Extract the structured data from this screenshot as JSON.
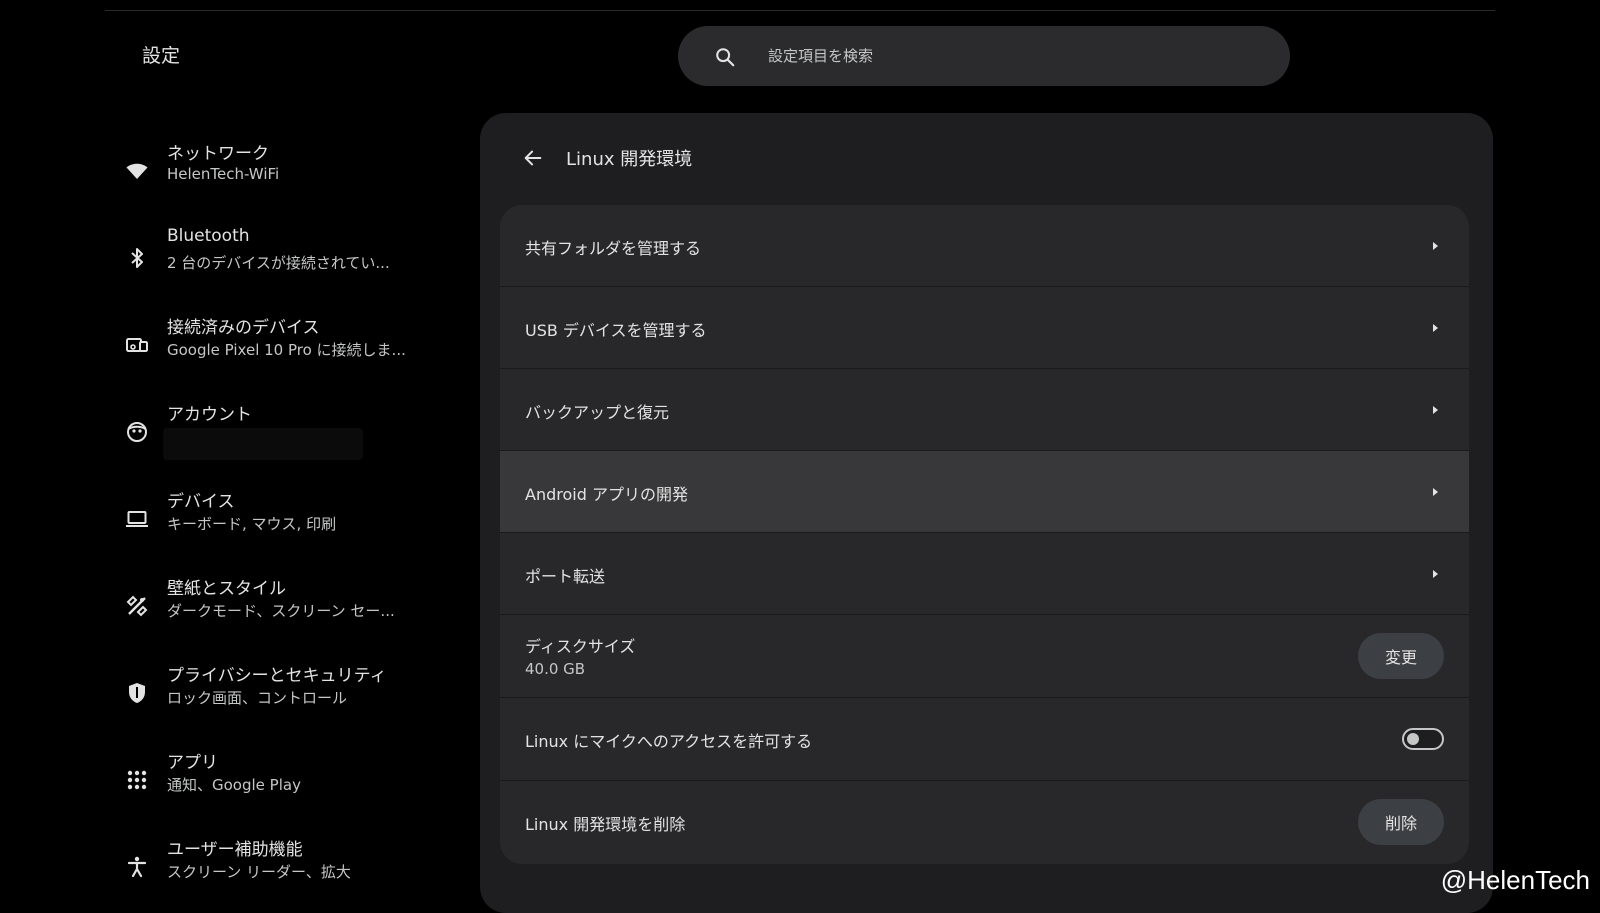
{
  "app": {
    "title": "設定"
  },
  "search": {
    "placeholder": "設定項目を検索"
  },
  "sidebar": {
    "items": [
      {
        "label": "ネットワーク",
        "sub": "HelenTech-WiFi",
        "icon": "wifi-icon"
      },
      {
        "label": "Bluetooth",
        "sub": "2 台のデバイスが接続されてい...",
        "icon": "bluetooth-icon"
      },
      {
        "label": "接続済みのデバイス",
        "sub": "Google Pixel 10 Pro に接続しま...",
        "icon": "connected-devices-icon"
      },
      {
        "label": "アカウント",
        "sub": "",
        "icon": "account-icon"
      },
      {
        "label": "デバイス",
        "sub": "キーボード, マウス, 印刷",
        "icon": "laptop-icon"
      },
      {
        "label": "壁紙とスタイル",
        "sub": "ダークモード、スクリーン セー...",
        "icon": "palette-icon"
      },
      {
        "label": "プライバシーとセキュリティ",
        "sub": "ロック画面、コントロール",
        "icon": "shield-icon"
      },
      {
        "label": "アプリ",
        "sub": "通知、Google Play",
        "icon": "apps-grid-icon"
      },
      {
        "label": "ユーザー補助機能",
        "sub": "スクリーン リーダー、拡大",
        "icon": "accessibility-icon"
      }
    ]
  },
  "panel": {
    "title": "Linux 開発環境",
    "rows": {
      "shared_folders": "共有フォルダを管理する",
      "usb_devices": "USB デバイスを管理する",
      "backup_restore": "バックアップと復元",
      "android_dev": "Android アプリの開発",
      "port_forwarding": "ポート転送",
      "disk_size": {
        "label": "ディスクサイズ",
        "value": "40.0 GB",
        "button": "変更"
      },
      "mic_access": {
        "label": "Linux にマイクへのアクセスを許可する",
        "enabled": false
      },
      "remove": {
        "label": "Linux 開発環境を削除",
        "button": "削除"
      }
    }
  },
  "watermark": "@HelenTech",
  "colors": {
    "background": "#000000",
    "panel": "#1e1e20",
    "card": "#28282a",
    "highlight": "#38383a",
    "button": "#3c3f44"
  }
}
